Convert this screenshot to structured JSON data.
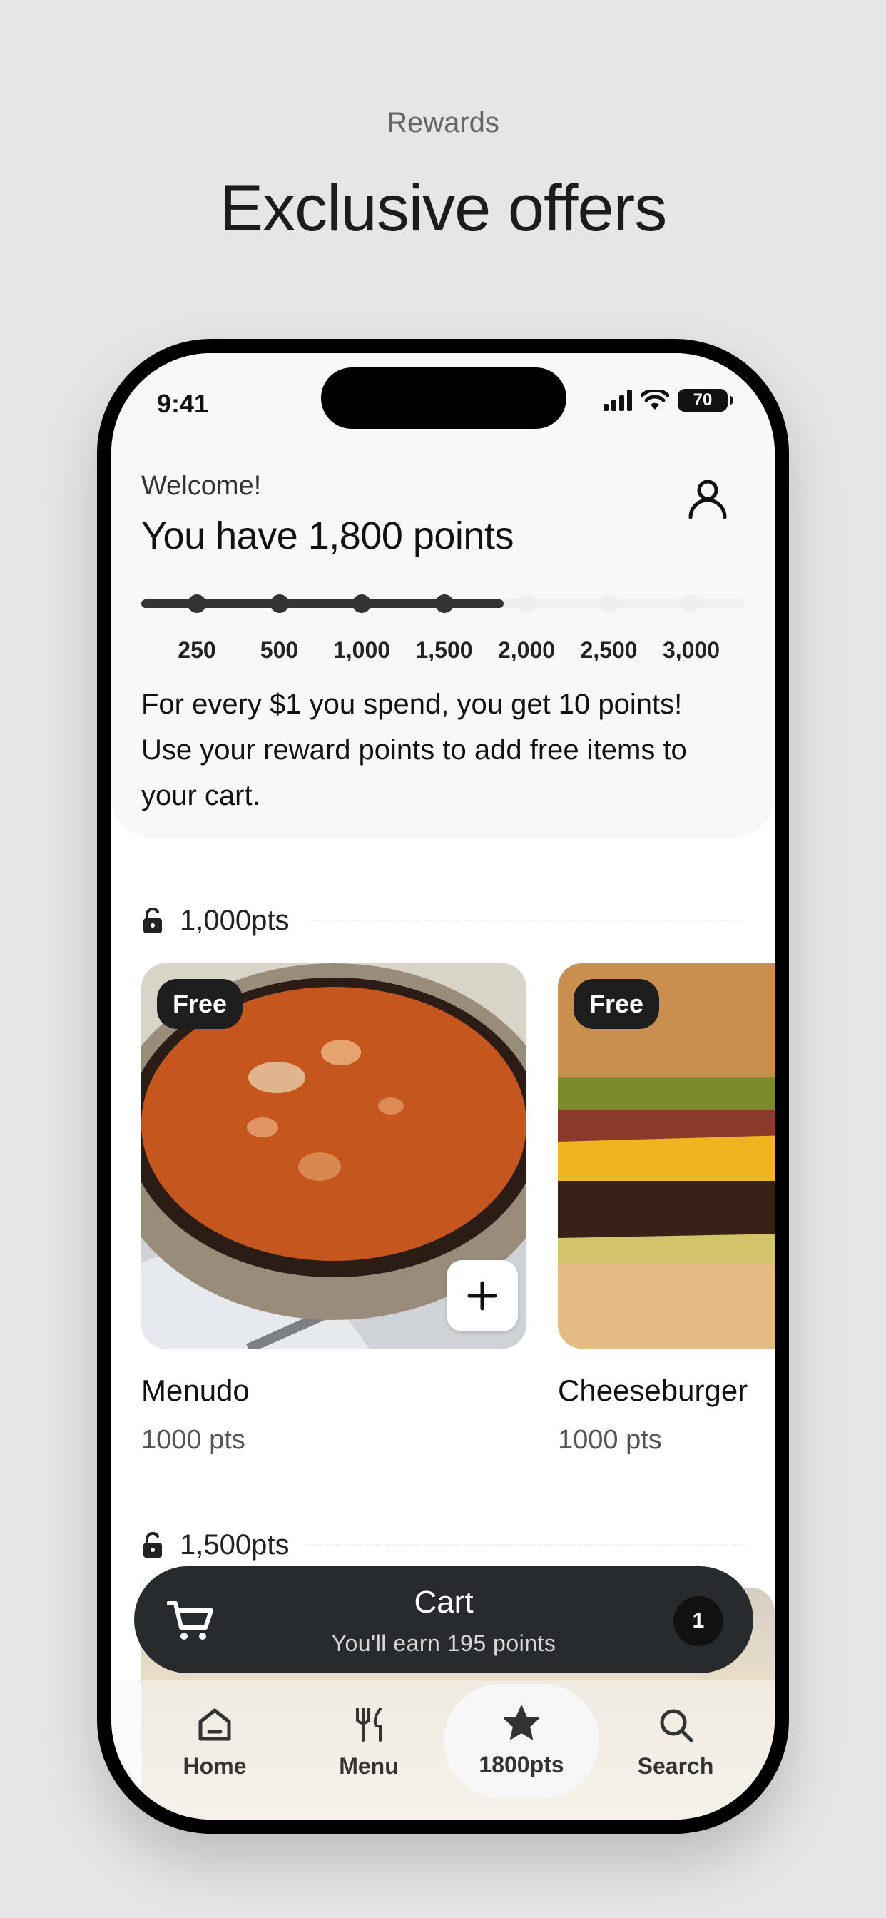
{
  "header": {
    "eyebrow": "Rewards",
    "title": "Exclusive offers"
  },
  "status_bar": {
    "time": "9:41",
    "battery": "70"
  },
  "rewards": {
    "welcome": "Welcome!",
    "points_title": "You have 1,800 points",
    "progress_fraction": 0.6,
    "milestones": [
      "250",
      "500",
      "1,000",
      "1,500",
      "2,000",
      "2,500",
      "3,000"
    ],
    "reached_count": 4,
    "description": "For every $1 you spend, you get 10 points! Use your reward points to add free items to your cart."
  },
  "tiers": [
    {
      "label": "1,000pts"
    },
    {
      "label": "1,500pts"
    }
  ],
  "items": [
    {
      "badge": "Free",
      "name": "Menudo",
      "points": "1000 pts"
    },
    {
      "badge": "Free",
      "name": "Cheeseburger",
      "points": "1000 pts"
    }
  ],
  "cart": {
    "title": "Cart",
    "subtitle": "You'll earn 195 points",
    "count": "1"
  },
  "tabs": [
    {
      "label": "Home",
      "icon": "home-icon"
    },
    {
      "label": "Menu",
      "icon": "utensils-icon"
    },
    {
      "label": "1800pts",
      "icon": "star-icon"
    },
    {
      "label": "Search",
      "icon": "search-icon"
    }
  ],
  "colors": {
    "accent_dark": "#282b2e",
    "progress_fill": "#333333",
    "progress_track": "#efefef"
  }
}
